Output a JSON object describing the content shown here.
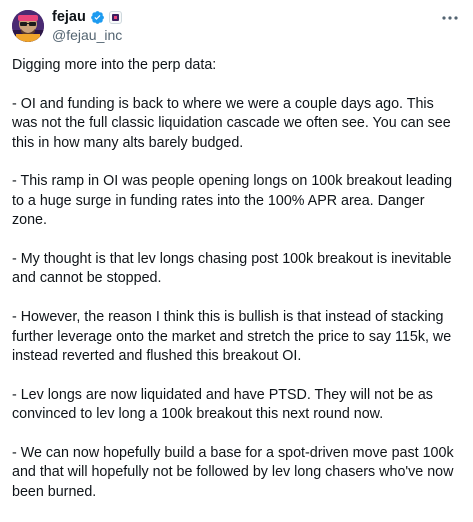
{
  "author": {
    "display_name": "fejau",
    "handle": "@fejau_inc",
    "avatar_icon": "avatar-image",
    "verified_icon": "verified-badge-icon",
    "affiliate_icon": "affiliate-badge-icon"
  },
  "more_icon": "more-options-icon",
  "colors": {
    "text": "#0f1419",
    "secondary": "#536471",
    "verified": "#1d9bf0"
  },
  "tweet": {
    "paragraphs": [
      "Digging more into the perp data:",
      "- OI and funding is back to where we were a couple days ago. This was not the full classic liquidation cascade we often see. You can see this in how many alts barely budged.",
      "- This ramp in OI was people opening longs on 100k breakout leading to a huge surge in funding rates into the 100% APR area. Danger zone.",
      "- My thought is that lev longs chasing post 100k breakout is inevitable and cannot be stopped.",
      "- However, the reason I think this is bullish is that instead of stacking further leverage onto the market and stretch the price to say 115k, we instead reverted and flushed this breakout OI.",
      "- Lev longs are now liquidated and have PTSD. They will not be as convinced to lev long a 100k breakout this next round now.",
      "- We can now hopefully build a base for a spot-driven move past 100k and that will hopefully not be followed by lev long chasers who've now been burned."
    ]
  }
}
